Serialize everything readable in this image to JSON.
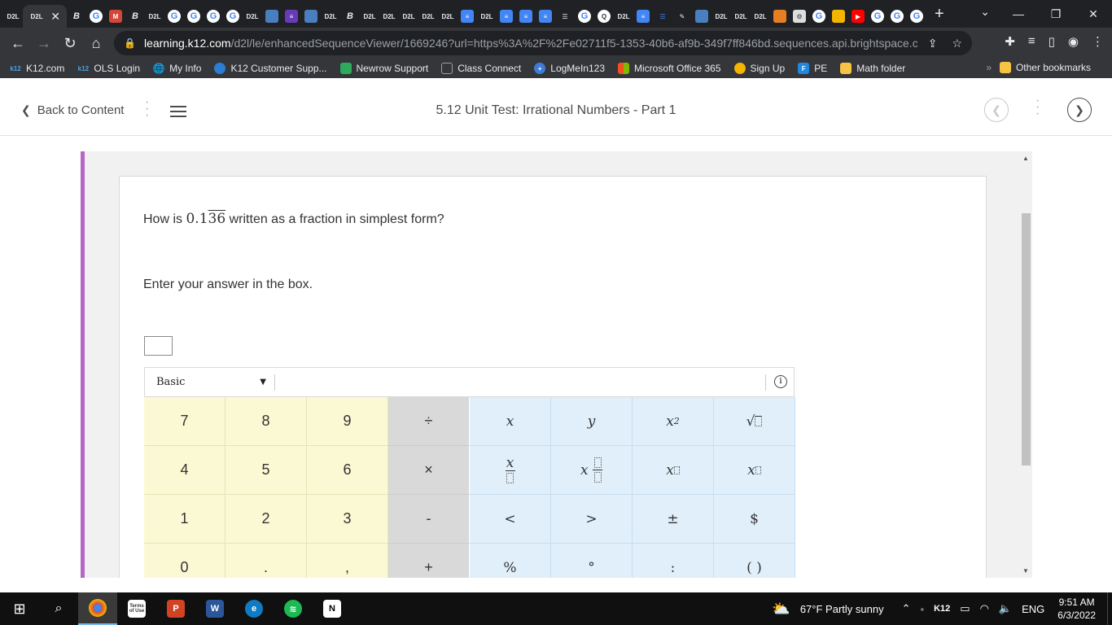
{
  "browser": {
    "tab_labels_d2l": "D2L",
    "tab_b": "B",
    "new_tab": "+",
    "url_host": "learning.k12.com",
    "url_path": "/d2l/le/enhancedSequenceViewer/1669246?url=https%3A%2F%2Fe02711f5-1353-40b6-af9b-349f7ff846bd.sequences.api.brightspace.c...",
    "bookmarks": [
      {
        "label": "K12.com",
        "icon": "k12-icon"
      },
      {
        "label": "OLS Login",
        "icon": "k12-icon"
      },
      {
        "label": "My Info",
        "icon": "globe-icon"
      },
      {
        "label": "K12 Customer Supp...",
        "icon": "k12-support-icon"
      },
      {
        "label": "Newrow Support",
        "icon": "newrow-icon"
      },
      {
        "label": "Class Connect",
        "icon": "class-connect-icon"
      },
      {
        "label": "LogMeIn123",
        "icon": "logmein-icon"
      },
      {
        "label": "Microsoft Office 365",
        "icon": "microsoft-icon"
      },
      {
        "label": "Sign Up",
        "icon": "signup-icon"
      },
      {
        "label": "PE",
        "icon": "pe-icon"
      },
      {
        "label": "Math folder",
        "icon": "folder-icon"
      }
    ],
    "other_bookmarks": "Other bookmarks"
  },
  "header": {
    "back_label": "Back to Content",
    "title": "5.12 Unit Test: Irrational Numbers - Part 1"
  },
  "question": {
    "prefix": "How is",
    "number_int": "0.1",
    "number_repeat": "36",
    "suffix": "written as a fraction in simplest form?",
    "instruction": "Enter your answer in the box."
  },
  "calculator": {
    "mode": "Basic",
    "info": "i",
    "rows": [
      [
        "7",
        "8",
        "9",
        "÷"
      ],
      [
        "4",
        "5",
        "6",
        "×"
      ],
      [
        "1",
        "2",
        "3",
        "-"
      ],
      [
        "0",
        ".",
        ",",
        "+"
      ]
    ],
    "fn_row1": {
      "a": "x",
      "b": "y",
      "c": "x",
      "c_sup": "2"
    },
    "fn_row3": [
      "<",
      ">",
      "±",
      "$"
    ],
    "fn_row4": [
      "%",
      "°",
      ":",
      "( )"
    ]
  },
  "taskbar": {
    "weather": "67°F  Partly sunny",
    "lang": "ENG",
    "time": "9:51 AM",
    "date": "6/3/2022",
    "terms_label": "Terms of Use",
    "k12": "K12"
  },
  "colors": {
    "accent_purple": "#b566c4",
    "num_key": "#fbf9d3",
    "op_key": "#d9d9d9",
    "fn_key": "#e0effa"
  }
}
